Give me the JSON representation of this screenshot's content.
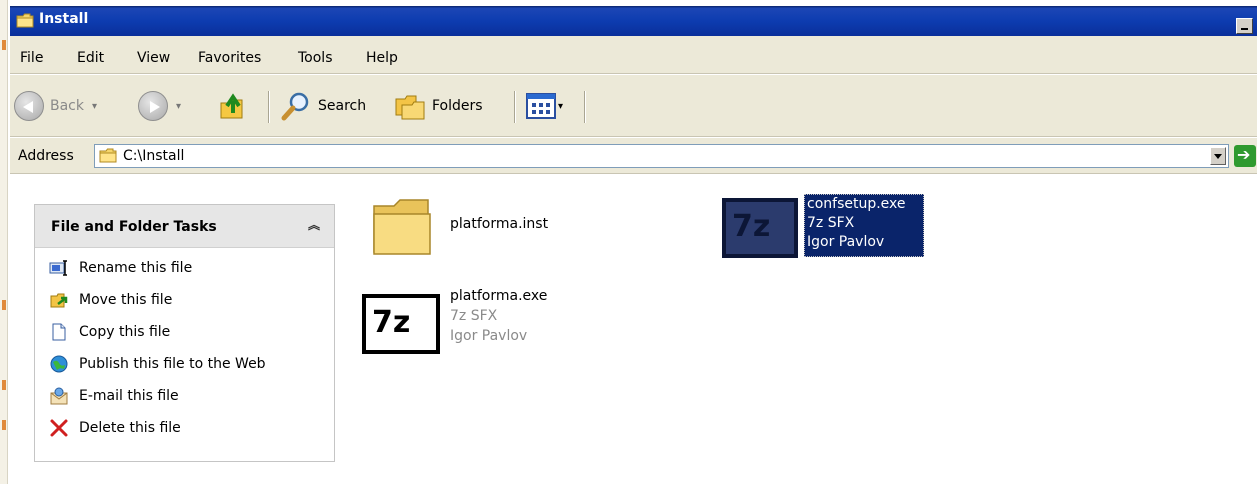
{
  "window": {
    "title": "Install"
  },
  "menubar": {
    "items": [
      "File",
      "Edit",
      "View",
      "Favorites",
      "Tools",
      "Help"
    ]
  },
  "toolbar": {
    "back_label": "Back",
    "search_label": "Search",
    "folders_label": "Folders"
  },
  "address": {
    "label": "Address",
    "value": "C:\\Install"
  },
  "tasks": {
    "title": "File and Folder Tasks",
    "items": [
      {
        "label": "Rename this file",
        "icon": "rename-icon"
      },
      {
        "label": "Move this file",
        "icon": "move-icon"
      },
      {
        "label": "Copy this file",
        "icon": "copy-icon"
      },
      {
        "label": "Publish this file to the Web",
        "icon": "publish-icon"
      },
      {
        "label": "E-mail this file",
        "icon": "email-icon"
      },
      {
        "label": "Delete this file",
        "icon": "delete-icon"
      }
    ]
  },
  "files": [
    {
      "name": "platforma.inst",
      "type": "folder"
    },
    {
      "name": "platforma.exe",
      "desc": "7z SFX",
      "company": "Igor Pavlov",
      "icon_text": "7z",
      "selected": false
    },
    {
      "name": "confsetup.exe",
      "desc": "7z SFX",
      "company": "Igor Pavlov",
      "icon_text": "7z",
      "selected": true
    }
  ],
  "colors": {
    "titlebar": "#0a3cb0",
    "selection": "#0a246a",
    "chrome": "#ece9d8"
  }
}
